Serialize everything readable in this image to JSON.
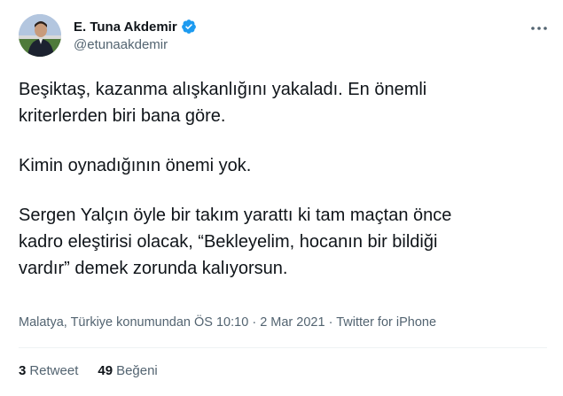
{
  "author": {
    "display_name": "E. Tuna Akdemir",
    "handle": "@etunaakdemir",
    "verified": true
  },
  "tweet": {
    "paragraphs": [
      [
        "Beşiktaş, kazanma alışkanlığını yakaladı. En önemli",
        "kriterlerden biri bana göre."
      ],
      [
        "Kimin oynadığının önemi yok."
      ],
      [
        "Sergen Yalçın öyle bir takım yarattı ki tam maçtan önce",
        "kadro eleştirisi olacak, “Bekleyelim, hocanın bir bildiği",
        "vardır” demek zorunda kalıyorsun."
      ]
    ]
  },
  "meta": {
    "location": "Malatya, Türkiye konumundan",
    "time": "ÖS 10:10",
    "date": "2 Mar 2021",
    "source": "Twitter for iPhone",
    "separator": "·"
  },
  "stats": {
    "retweets_count": "3",
    "retweets_label": "Retweet",
    "likes_count": "49",
    "likes_label": "Beğeni"
  },
  "colors": {
    "verified_blue": "#1d9bf0",
    "secondary_text": "#536471",
    "primary_text": "#0f1419"
  },
  "icons": {
    "verified": "verified-badge-icon",
    "more": "more-dots-icon"
  }
}
